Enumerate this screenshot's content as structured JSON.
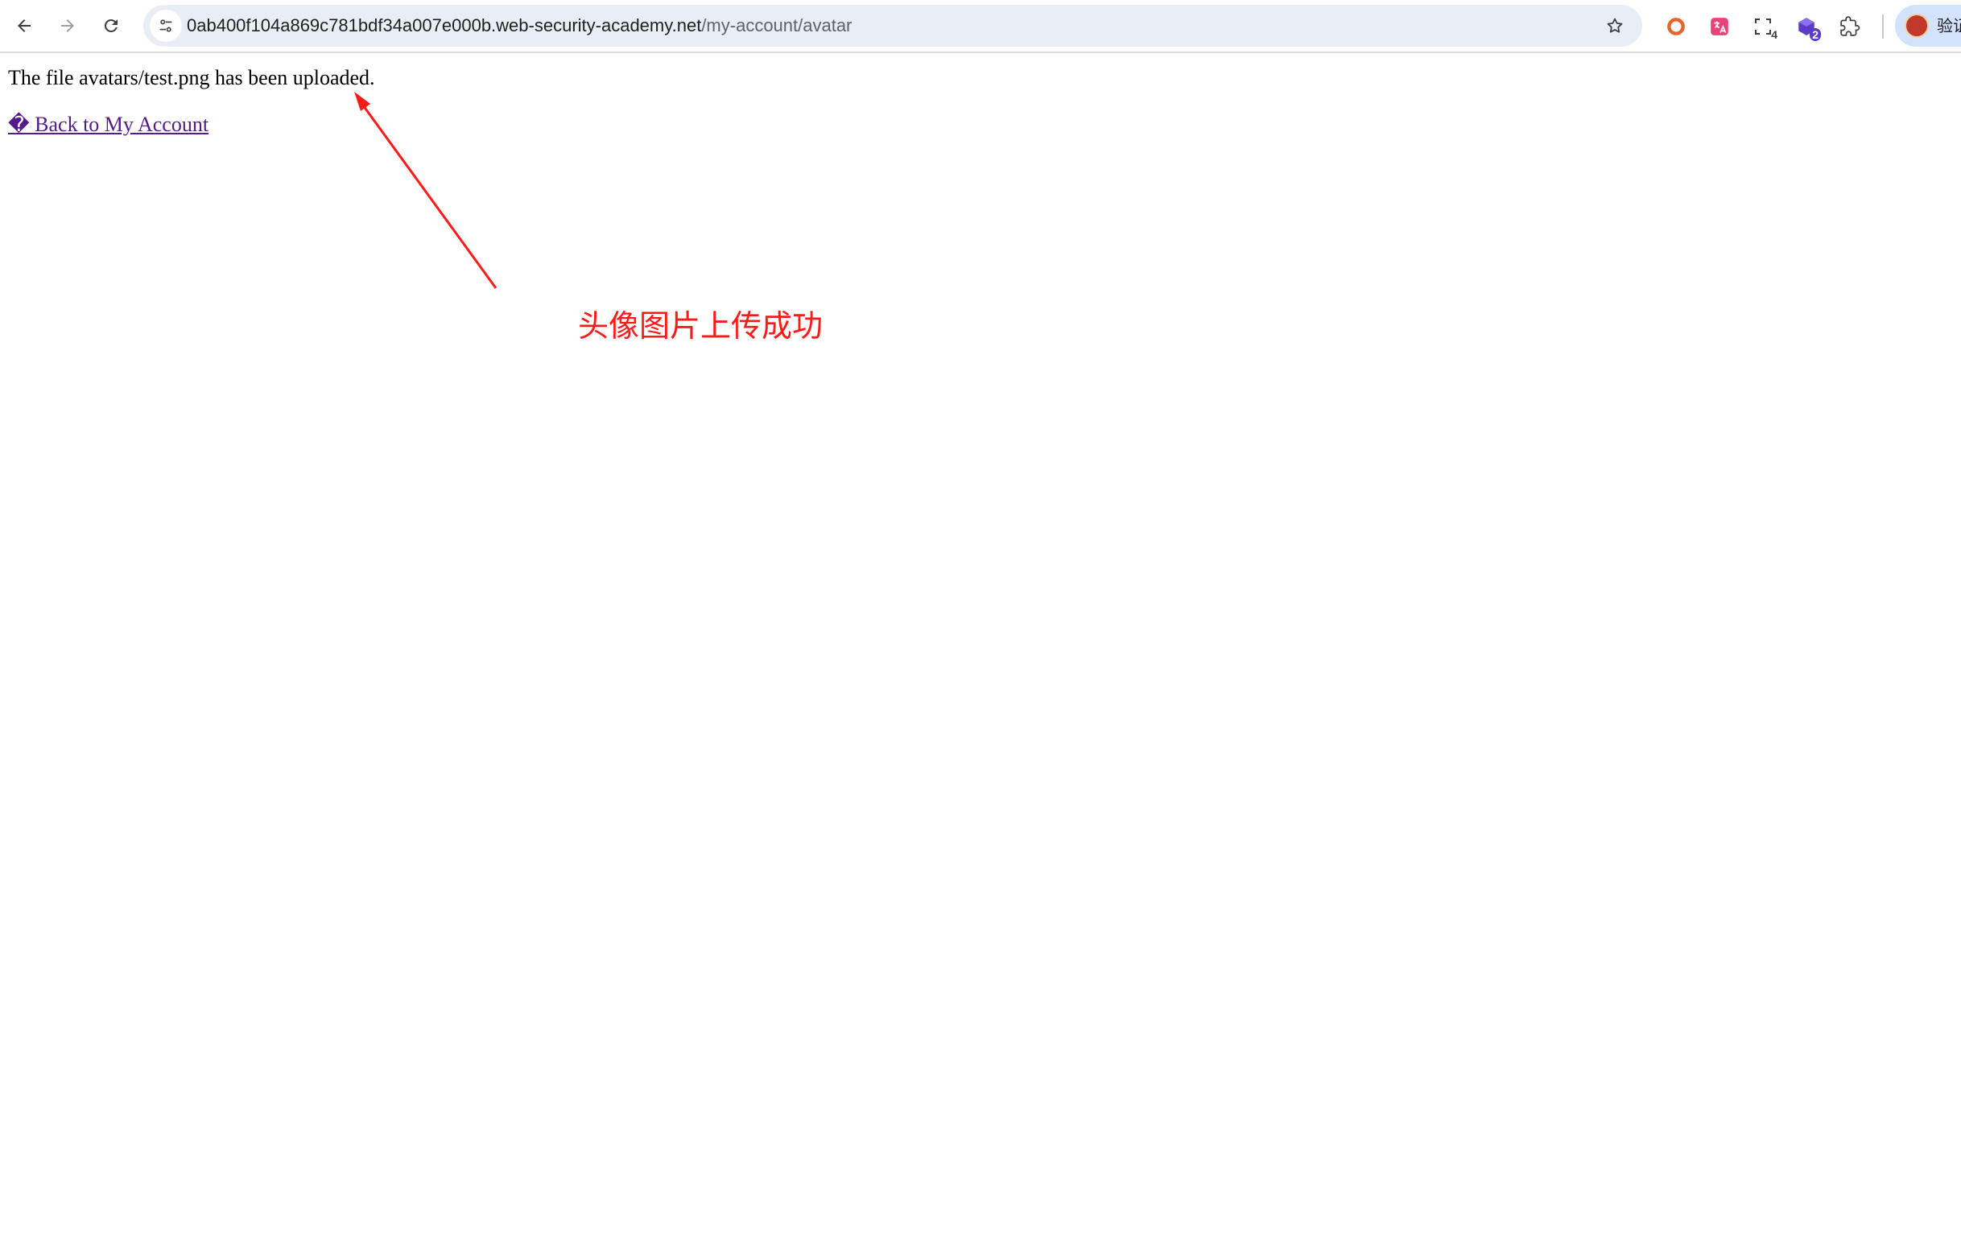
{
  "browser": {
    "url": {
      "host": "0ab400f104a869c781bdf34a007e000b.web-security-academy.net",
      "path": "/my-account/avatar"
    },
    "nav_icons": [
      "back-arrow-icon",
      "forward-arrow-icon",
      "reload-icon"
    ],
    "omnibox_icons": [
      "site-settings-icon",
      "bookmark-star-icon"
    ],
    "extensions": [
      {
        "name": "orange-ring-extension-icon",
        "color": "#e8632b"
      },
      {
        "name": "translate-extension-icon",
        "color": "#e8437a"
      },
      {
        "name": "screenshot-extension-icon",
        "badge": "4",
        "color": "#3c4043"
      },
      {
        "name": "cube-extension-icon",
        "badge": "2",
        "color": "#5b3cc4"
      },
      {
        "name": "puzzle-extensions-icon",
        "color": "#3c4043"
      }
    ],
    "profile": {
      "label": "验证",
      "avatar_color": "#c0392b"
    }
  },
  "page": {
    "message": "The file avatars/test.png has been uploaded.",
    "back_link": "� Back to My Account",
    "link_color": "#551a8b"
  },
  "annotation": {
    "text": "头像图片上传成功",
    "color": "#ff1a1a"
  }
}
